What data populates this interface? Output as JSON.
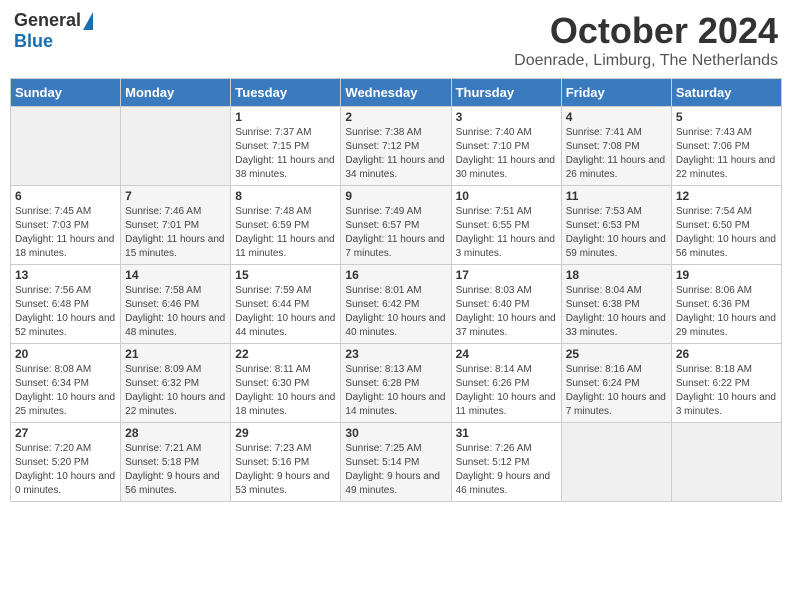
{
  "header": {
    "logo_general": "General",
    "logo_blue": "Blue",
    "month_title": "October 2024",
    "subtitle": "Doenrade, Limburg, The Netherlands"
  },
  "days_of_week": [
    "Sunday",
    "Monday",
    "Tuesday",
    "Wednesday",
    "Thursday",
    "Friday",
    "Saturday"
  ],
  "weeks": [
    [
      {
        "day": "",
        "details": ""
      },
      {
        "day": "",
        "details": ""
      },
      {
        "day": "1",
        "details": "Sunrise: 7:37 AM\nSunset: 7:15 PM\nDaylight: 11 hours and 38 minutes."
      },
      {
        "day": "2",
        "details": "Sunrise: 7:38 AM\nSunset: 7:12 PM\nDaylight: 11 hours and 34 minutes."
      },
      {
        "day": "3",
        "details": "Sunrise: 7:40 AM\nSunset: 7:10 PM\nDaylight: 11 hours and 30 minutes."
      },
      {
        "day": "4",
        "details": "Sunrise: 7:41 AM\nSunset: 7:08 PM\nDaylight: 11 hours and 26 minutes."
      },
      {
        "day": "5",
        "details": "Sunrise: 7:43 AM\nSunset: 7:06 PM\nDaylight: 11 hours and 22 minutes."
      }
    ],
    [
      {
        "day": "6",
        "details": "Sunrise: 7:45 AM\nSunset: 7:03 PM\nDaylight: 11 hours and 18 minutes."
      },
      {
        "day": "7",
        "details": "Sunrise: 7:46 AM\nSunset: 7:01 PM\nDaylight: 11 hours and 15 minutes."
      },
      {
        "day": "8",
        "details": "Sunrise: 7:48 AM\nSunset: 6:59 PM\nDaylight: 11 hours and 11 minutes."
      },
      {
        "day": "9",
        "details": "Sunrise: 7:49 AM\nSunset: 6:57 PM\nDaylight: 11 hours and 7 minutes."
      },
      {
        "day": "10",
        "details": "Sunrise: 7:51 AM\nSunset: 6:55 PM\nDaylight: 11 hours and 3 minutes."
      },
      {
        "day": "11",
        "details": "Sunrise: 7:53 AM\nSunset: 6:53 PM\nDaylight: 10 hours and 59 minutes."
      },
      {
        "day": "12",
        "details": "Sunrise: 7:54 AM\nSunset: 6:50 PM\nDaylight: 10 hours and 56 minutes."
      }
    ],
    [
      {
        "day": "13",
        "details": "Sunrise: 7:56 AM\nSunset: 6:48 PM\nDaylight: 10 hours and 52 minutes."
      },
      {
        "day": "14",
        "details": "Sunrise: 7:58 AM\nSunset: 6:46 PM\nDaylight: 10 hours and 48 minutes."
      },
      {
        "day": "15",
        "details": "Sunrise: 7:59 AM\nSunset: 6:44 PM\nDaylight: 10 hours and 44 minutes."
      },
      {
        "day": "16",
        "details": "Sunrise: 8:01 AM\nSunset: 6:42 PM\nDaylight: 10 hours and 40 minutes."
      },
      {
        "day": "17",
        "details": "Sunrise: 8:03 AM\nSunset: 6:40 PM\nDaylight: 10 hours and 37 minutes."
      },
      {
        "day": "18",
        "details": "Sunrise: 8:04 AM\nSunset: 6:38 PM\nDaylight: 10 hours and 33 minutes."
      },
      {
        "day": "19",
        "details": "Sunrise: 8:06 AM\nSunset: 6:36 PM\nDaylight: 10 hours and 29 minutes."
      }
    ],
    [
      {
        "day": "20",
        "details": "Sunrise: 8:08 AM\nSunset: 6:34 PM\nDaylight: 10 hours and 25 minutes."
      },
      {
        "day": "21",
        "details": "Sunrise: 8:09 AM\nSunset: 6:32 PM\nDaylight: 10 hours and 22 minutes."
      },
      {
        "day": "22",
        "details": "Sunrise: 8:11 AM\nSunset: 6:30 PM\nDaylight: 10 hours and 18 minutes."
      },
      {
        "day": "23",
        "details": "Sunrise: 8:13 AM\nSunset: 6:28 PM\nDaylight: 10 hours and 14 minutes."
      },
      {
        "day": "24",
        "details": "Sunrise: 8:14 AM\nSunset: 6:26 PM\nDaylight: 10 hours and 11 minutes."
      },
      {
        "day": "25",
        "details": "Sunrise: 8:16 AM\nSunset: 6:24 PM\nDaylight: 10 hours and 7 minutes."
      },
      {
        "day": "26",
        "details": "Sunrise: 8:18 AM\nSunset: 6:22 PM\nDaylight: 10 hours and 3 minutes."
      }
    ],
    [
      {
        "day": "27",
        "details": "Sunrise: 7:20 AM\nSunset: 5:20 PM\nDaylight: 10 hours and 0 minutes."
      },
      {
        "day": "28",
        "details": "Sunrise: 7:21 AM\nSunset: 5:18 PM\nDaylight: 9 hours and 56 minutes."
      },
      {
        "day": "29",
        "details": "Sunrise: 7:23 AM\nSunset: 5:16 PM\nDaylight: 9 hours and 53 minutes."
      },
      {
        "day": "30",
        "details": "Sunrise: 7:25 AM\nSunset: 5:14 PM\nDaylight: 9 hours and 49 minutes."
      },
      {
        "day": "31",
        "details": "Sunrise: 7:26 AM\nSunset: 5:12 PM\nDaylight: 9 hours and 46 minutes."
      },
      {
        "day": "",
        "details": ""
      },
      {
        "day": "",
        "details": ""
      }
    ]
  ]
}
